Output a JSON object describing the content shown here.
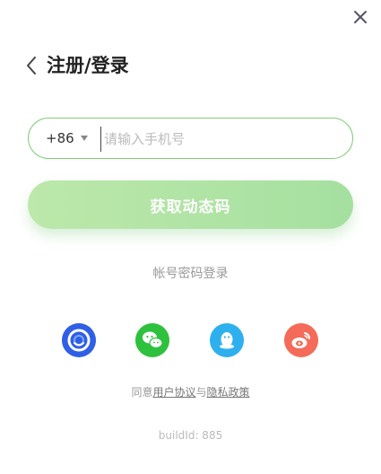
{
  "header": {
    "title": "注册/登录"
  },
  "phone": {
    "country_code": "+86",
    "placeholder": "请输入手机号"
  },
  "buttons": {
    "get_code": "获取动态码",
    "password_login": "帐号密码登录"
  },
  "social": [
    {
      "name": "circle-logo-icon",
      "color": "#2f5fe6"
    },
    {
      "name": "wechat-icon",
      "color": "#2ec13d"
    },
    {
      "name": "qq-icon",
      "color": "#2fb0ee"
    },
    {
      "name": "weibo-icon",
      "color": "#f46b5a"
    }
  ],
  "agreement": {
    "prefix": "同意",
    "user_agreement": "用户协议",
    "and": "与",
    "privacy_policy": "隐私政策"
  },
  "footer": {
    "build": "buildId: 885"
  },
  "colors": {
    "accent": "#7fcf75",
    "button_gradient_start": "#bce8ab",
    "button_gradient_end": "#a5e0a0"
  }
}
